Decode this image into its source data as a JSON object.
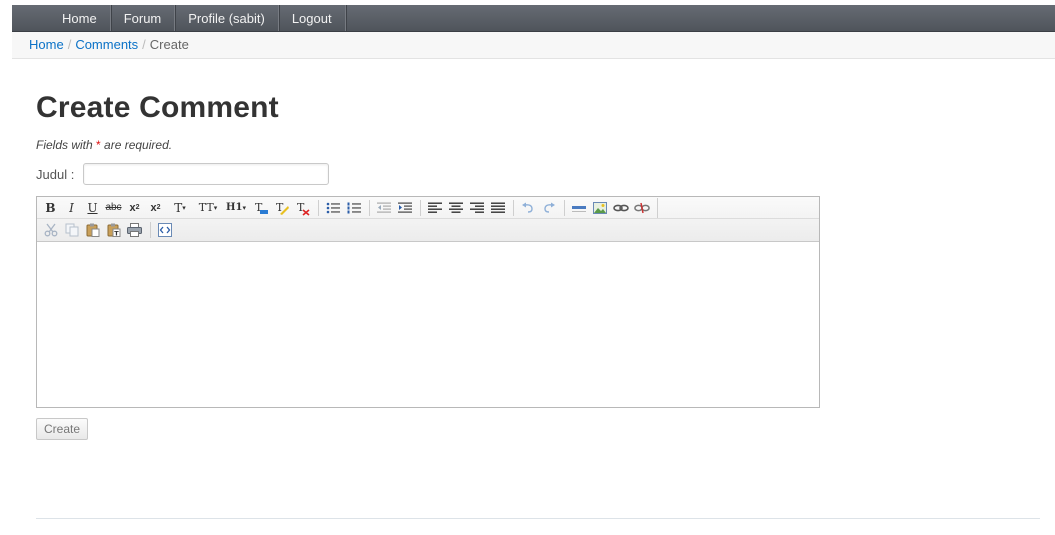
{
  "nav": {
    "items": [
      {
        "label": "Home"
      },
      {
        "label": "Forum"
      },
      {
        "label": "Profile (sabit)"
      },
      {
        "label": "Logout"
      }
    ]
  },
  "breadcrumb": {
    "items": [
      {
        "label": "Home"
      },
      {
        "label": "Comments"
      }
    ],
    "current": "Create",
    "separator": "/"
  },
  "page": {
    "title": "Create Comment",
    "note_prefix": "Fields with ",
    "note_star": "*",
    "note_suffix": " are required."
  },
  "form": {
    "judul_label": "Judul :",
    "judul_value": "",
    "submit_label": "Create"
  },
  "toolbar": {
    "row1": [
      {
        "name": "bold",
        "icon": "bold-icon",
        "text": "B"
      },
      {
        "name": "italic",
        "icon": "italic-icon",
        "text": "I"
      },
      {
        "name": "underline",
        "icon": "underline-icon",
        "text": "U"
      },
      {
        "name": "strikethrough",
        "icon": "strikethrough-icon",
        "text": "abc"
      },
      {
        "name": "subscript",
        "icon": "subscript-icon",
        "text": "x₂"
      },
      {
        "name": "superscript",
        "icon": "superscript-icon",
        "text": "x²"
      },
      {
        "name": "font-size",
        "icon": "font-size-icon",
        "text": "T▾"
      },
      {
        "name": "font-family",
        "icon": "font-family-icon",
        "text": "TT▾"
      },
      {
        "name": "heading",
        "icon": "heading-icon",
        "text": "H1▾"
      },
      {
        "name": "font-color",
        "icon": "font-color-icon",
        "text": "T"
      },
      {
        "name": "highlight",
        "icon": "highlight-icon",
        "text": "T"
      },
      {
        "name": "remove-format",
        "icon": "remove-format-icon",
        "text": "T"
      },
      {
        "name": "bullet-list",
        "icon": "bullet-list-icon"
      },
      {
        "name": "numbered-list",
        "icon": "numbered-list-icon"
      },
      {
        "name": "outdent",
        "icon": "outdent-icon"
      },
      {
        "name": "indent",
        "icon": "indent-icon"
      },
      {
        "name": "align-left",
        "icon": "align-left-icon"
      },
      {
        "name": "align-center",
        "icon": "align-center-icon"
      },
      {
        "name": "align-right",
        "icon": "align-right-icon"
      },
      {
        "name": "justify",
        "icon": "justify-icon"
      },
      {
        "name": "undo",
        "icon": "undo-icon"
      },
      {
        "name": "redo",
        "icon": "redo-icon"
      },
      {
        "name": "horizontal-rule",
        "icon": "horizontal-rule-icon"
      },
      {
        "name": "image",
        "icon": "image-icon"
      },
      {
        "name": "link",
        "icon": "link-icon"
      },
      {
        "name": "unlink",
        "icon": "unlink-icon"
      }
    ],
    "row2": [
      {
        "name": "cut",
        "icon": "cut-icon"
      },
      {
        "name": "copy",
        "icon": "copy-icon"
      },
      {
        "name": "paste",
        "icon": "paste-icon"
      },
      {
        "name": "paste-text",
        "icon": "paste-text-icon"
      },
      {
        "name": "print",
        "icon": "print-icon"
      },
      {
        "name": "source",
        "icon": "source-code-icon"
      }
    ]
  },
  "colors": {
    "topbar": "#565b62",
    "link": "#0b72c7",
    "required": "#dd1111"
  }
}
